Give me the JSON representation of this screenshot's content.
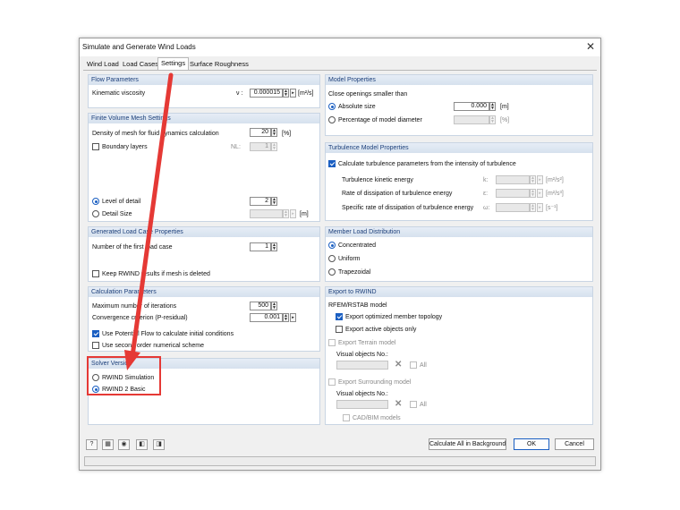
{
  "window": {
    "title": "Simulate and Generate Wind Loads"
  },
  "tabs": [
    "Wind Load",
    "Load Cases",
    "Settings",
    "Surface Roughness"
  ],
  "active_tab": "Settings",
  "flow": {
    "header": "Flow Parameters",
    "kinematic_label": "Kinematic viscosity",
    "kinematic_symbol": "ν :",
    "kinematic_value": "0.000015",
    "kinematic_unit": "[m²/s]"
  },
  "mesh": {
    "header": "Finite Volume Mesh Settings",
    "density_label": "Density of mesh for fluid dynamics calculation",
    "density_value": "20",
    "density_unit": "[%]",
    "boundary_label": "Boundary layers",
    "nl_label": "NL:",
    "nl_value": "1",
    "level_label": "Level of detail",
    "level_value": "2",
    "detail_size_label": "Detail Size",
    "detail_size_unit": "[m]"
  },
  "load_case": {
    "header": "Generated Load Case Properties",
    "first_case_label": "Number of the first load case",
    "first_case_value": "1",
    "keep_label": "Keep RWIND results if mesh is deleted"
  },
  "calc": {
    "header": "Calculation Parameters",
    "max_iter_label": "Maximum number of iterations",
    "max_iter_value": "500",
    "conv_label": "Convergence criterion (P-residual)",
    "conv_value": "0.001",
    "potential_label": "Use Potential Flow to calculate initial conditions",
    "second_order_label": "Use second order numerical scheme"
  },
  "solver": {
    "header": "Solver Version",
    "opt1": "RWIND Simulation",
    "opt2": "RWIND 2 Basic"
  },
  "model": {
    "header": "Model Properties",
    "close_label": "Close openings smaller than",
    "absolute_label": "Absolute size",
    "absolute_value": "0.000",
    "absolute_unit": "[m]",
    "percent_label": "Percentage of model diameter",
    "percent_unit": "[%]"
  },
  "turbulence": {
    "header": "Turbulence Model Properties",
    "calc_label": "Calculate turbulence parameters from the intensity of turbulence",
    "tke_label": "Turbulence kinetic energy",
    "tke_symbol": "k:",
    "tke_unit": "[m²/s²]",
    "diss_label": "Rate of dissipation of turbulence energy",
    "diss_symbol": "ε:",
    "diss_unit": "[m²/s³]",
    "spec_label": "Specific rate of dissipation of turbulence energy",
    "spec_symbol": "ω:",
    "spec_unit": "[s⁻¹]"
  },
  "member": {
    "header": "Member Load Distribution",
    "opt1": "Concentrated",
    "opt2": "Uniform",
    "opt3": "Trapezoidal"
  },
  "export": {
    "header": "Export to RWIND",
    "rfem_label": "RFEM/RSTAB model",
    "optimized_label": "Export optimized member topology",
    "active_label": "Export active objects only",
    "terrain_label": "Export Terrain model",
    "visual_label1": "Visual objects No.:",
    "all_label1": "All",
    "surrounding_label": "Export Surrounding model",
    "visual_label2": "Visual objects No.:",
    "all_label2": "All",
    "cad_label": "CAD/BIM models"
  },
  "footer": {
    "calc_all": "Calculate All in Background",
    "ok": "OK",
    "cancel": "Cancel"
  },
  "colors": {
    "accent": "#1b5fc2",
    "highlight": "#e53935",
    "arrow": "#e53935"
  }
}
